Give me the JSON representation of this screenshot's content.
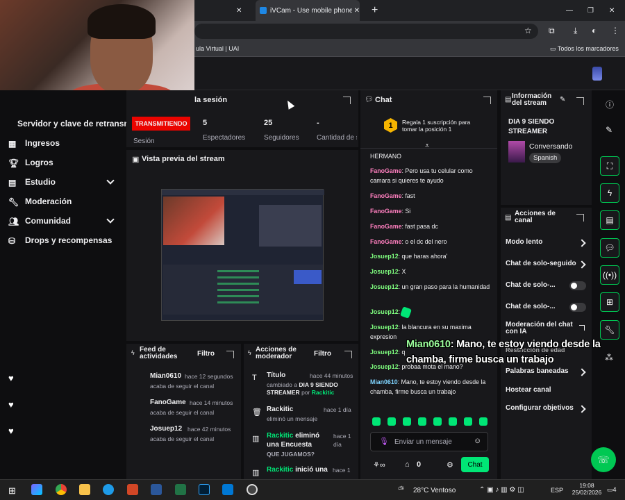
{
  "browser": {
    "tabs": [
      {
        "label": "iVCam - Use mobile phone as a"
      }
    ],
    "bookmarks": {
      "left": "ula Virtual | UAI",
      "right": "Todos los marcadores"
    }
  },
  "sidebar": {
    "header": "Servidor y clave de retransm",
    "items": [
      {
        "label": "Ingresos",
        "icon": "grid-icon"
      },
      {
        "label": "Logros",
        "icon": "trophy-icon"
      },
      {
        "label": "Estudio",
        "icon": "studio-icon",
        "expand": true
      },
      {
        "label": "Moderación",
        "icon": "wrench-icon"
      },
      {
        "label": "Comunidad",
        "icon": "people-icon",
        "expand": true
      },
      {
        "label": "Drops y recompensas",
        "icon": "gift-icon"
      }
    ]
  },
  "session": {
    "title": "la sesión",
    "live_badge": "TRANSMITIENDO",
    "badge_color": "#eb0400",
    "stats": [
      {
        "value": "",
        "label": "Sesión"
      },
      {
        "value": "5",
        "label": "Espectadores"
      },
      {
        "value": "25",
        "label": "Seguidores"
      },
      {
        "value": "-",
        "label": "Cantidad de suscripción"
      }
    ]
  },
  "preview": {
    "title": "Vista previa del stream"
  },
  "feed": {
    "title": "Feed de actividades",
    "filter": "Filtro",
    "items": [
      {
        "user": "Mian0610",
        "time": "hace 12 segundos",
        "sub": "acaba de seguir el canal"
      },
      {
        "user": "FanoGame",
        "time": "hace 14 minutos",
        "sub": "acaba de seguir el canal"
      },
      {
        "user": "Josuep12",
        "time": "hace 42 minutos",
        "sub": "acaba de seguir el canal"
      }
    ]
  },
  "modactions": {
    "title": "Acciones de moderador",
    "filter": "Filtro",
    "items": [
      {
        "title": "Título",
        "time": "hace 44 minutos",
        "l1": "cambiado a",
        "bold": "DIA 9 SIENDO STREAMER",
        "l2": "por",
        "user": "Rackitic"
      },
      {
        "title": "Rackitic",
        "time": "hace 1 día",
        "l1": "eliminó un mensaje"
      },
      {
        "user": "Rackitic",
        "title": "eliminó una Encuesta",
        "time": "hace 1 día",
        "l1": "QUE JUGAMOS?"
      },
      {
        "user": "Rackitic",
        "title": "inició una",
        "time": "hace 1"
      }
    ]
  },
  "chat": {
    "title": "Chat",
    "promo": "Regala 1 suscripción para tomar la posición 1",
    "promo_rank": "1",
    "messages": [
      {
        "user": "",
        "text": "HERMANO"
      },
      {
        "user": "FanoGame",
        "text": "Pero usa tu celular como camara si quieres te ayudo",
        "color": "#ff7fbf"
      },
      {
        "user": "FanoGame",
        "text": "fast",
        "color": "#ff7fbf"
      },
      {
        "user": "FanoGame",
        "text": "Si",
        "color": "#ff7fbf"
      },
      {
        "user": "FanoGame",
        "text": "fast pasa dc",
        "color": "#ff7fbf"
      },
      {
        "user": "FanoGame",
        "text": "o el dc del nero",
        "color": "#ff7fbf"
      },
      {
        "user": "Josuep12",
        "text": "que haras ahora'",
        "color": "#7fff7f"
      },
      {
        "user": "Josuep12",
        "text": "X",
        "color": "#7fff7f"
      },
      {
        "user": "Josuep12",
        "text": "un gran paso para la humanidad",
        "color": "#7fff7f"
      },
      {
        "user": "Josuep12",
        "text": "",
        "color": "#7fff7f"
      },
      {
        "user": "Josuep12",
        "text": "la blancura en su maxima expresion",
        "color": "#7fff7f"
      },
      {
        "user": "Josuep12",
        "text": "q",
        "color": "#7fff7f"
      },
      {
        "user": "Josuep12",
        "text": "probaa mota el mano?",
        "color": "#7fff7f"
      },
      {
        "user": "Mian0610",
        "text": "Mano, te estoy viendo desde la chamba, firme busca un trabajo",
        "color": "#7fd4ff"
      }
    ],
    "input_placeholder": "Enviar un mensaje",
    "points": "0",
    "send": "Chat"
  },
  "overlay": {
    "user": "Mian0610",
    "text": ": Mano, te estoy viendo desde la chamba, firme busca un trabajo"
  },
  "info": {
    "title": "Información del stream",
    "stream_title": "DIA 9 SIENDO STREAMER",
    "category": "Conversando",
    "tag": "Spanish"
  },
  "channel": {
    "title": "Acciones de canal",
    "items": [
      {
        "label": "Modo lento",
        "kind": "chev"
      },
      {
        "label": "Chat de solo-seguido",
        "kind": "chev"
      },
      {
        "label": "Chat de solo-...",
        "kind": "toggle"
      },
      {
        "label": "Chat de solo-...",
        "kind": "toggle"
      },
      {
        "label": "Moderación del chat con IA",
        "kind": "ext"
      },
      {
        "label": "Restricción de edad",
        "kind": "chev"
      },
      {
        "label": "Palabras baneadas",
        "kind": "chev"
      },
      {
        "label": "Hostear canal",
        "kind": "none"
      },
      {
        "label": "Configurar objetivos",
        "kind": "chev"
      }
    ]
  },
  "taskbar": {
    "weather": "28°C Ventoso",
    "lang": "ESP",
    "time": "19:08",
    "date": "25/02/2026",
    "notif": "4"
  },
  "accent": "#00e676"
}
